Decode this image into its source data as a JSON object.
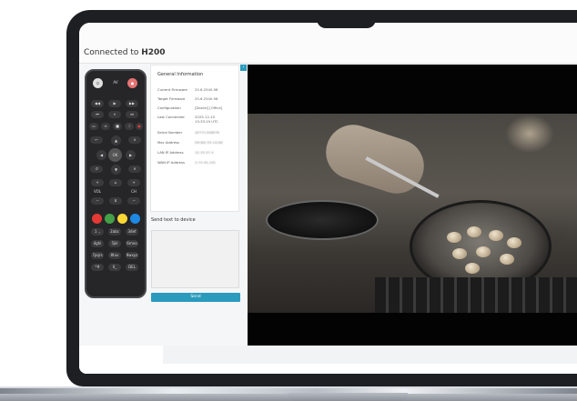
{
  "header": {
    "connected_prefix": "Connected to",
    "device_name": "H200"
  },
  "info": {
    "title": "General Information",
    "rows": [
      {
        "label": "Current Firmware",
        "value": "25.6.2540.98"
      },
      {
        "label": "Target Firmware",
        "value": "25.6.2540.98"
      },
      {
        "label": "Configuration",
        "value": "[Daniel] [Office]"
      },
      {
        "label": "Last Connected",
        "value": "2025-12-10",
        "value2": "13:33:19 UTC"
      },
      {
        "label": "Serial Number",
        "value": "2ET-Y1306876"
      },
      {
        "label": "Mac Address",
        "value": "D9:BD:35:1D:8E"
      },
      {
        "label": "LAN IP Address",
        "value": "10.35.57.4"
      },
      {
        "label": "WAN IP Address",
        "value": "3.74.40.192"
      }
    ]
  },
  "send": {
    "label": "Send text to device",
    "button": "Send",
    "text": ""
  },
  "remote": {
    "labels": {
      "av": "AV",
      "ok": "OK",
      "vol": "VOL",
      "ch": "CH",
      "k1": "1 .,",
      "k2": "2abc",
      "k3": "3def",
      "k4": "4ghi",
      "k5": "5jkl",
      "k6": "6mno",
      "k7": "7pqrs",
      "k8": "8tuv",
      "k9": "9wxyz",
      "kstar": "*#",
      "k0": "0_",
      "kdel": "DEL"
    },
    "colors": {
      "red": "#e53935",
      "green": "#43a047",
      "yellow": "#fdd835",
      "blue": "#1e88e5"
    }
  },
  "colors": {
    "accent": "#2a9bbd"
  }
}
